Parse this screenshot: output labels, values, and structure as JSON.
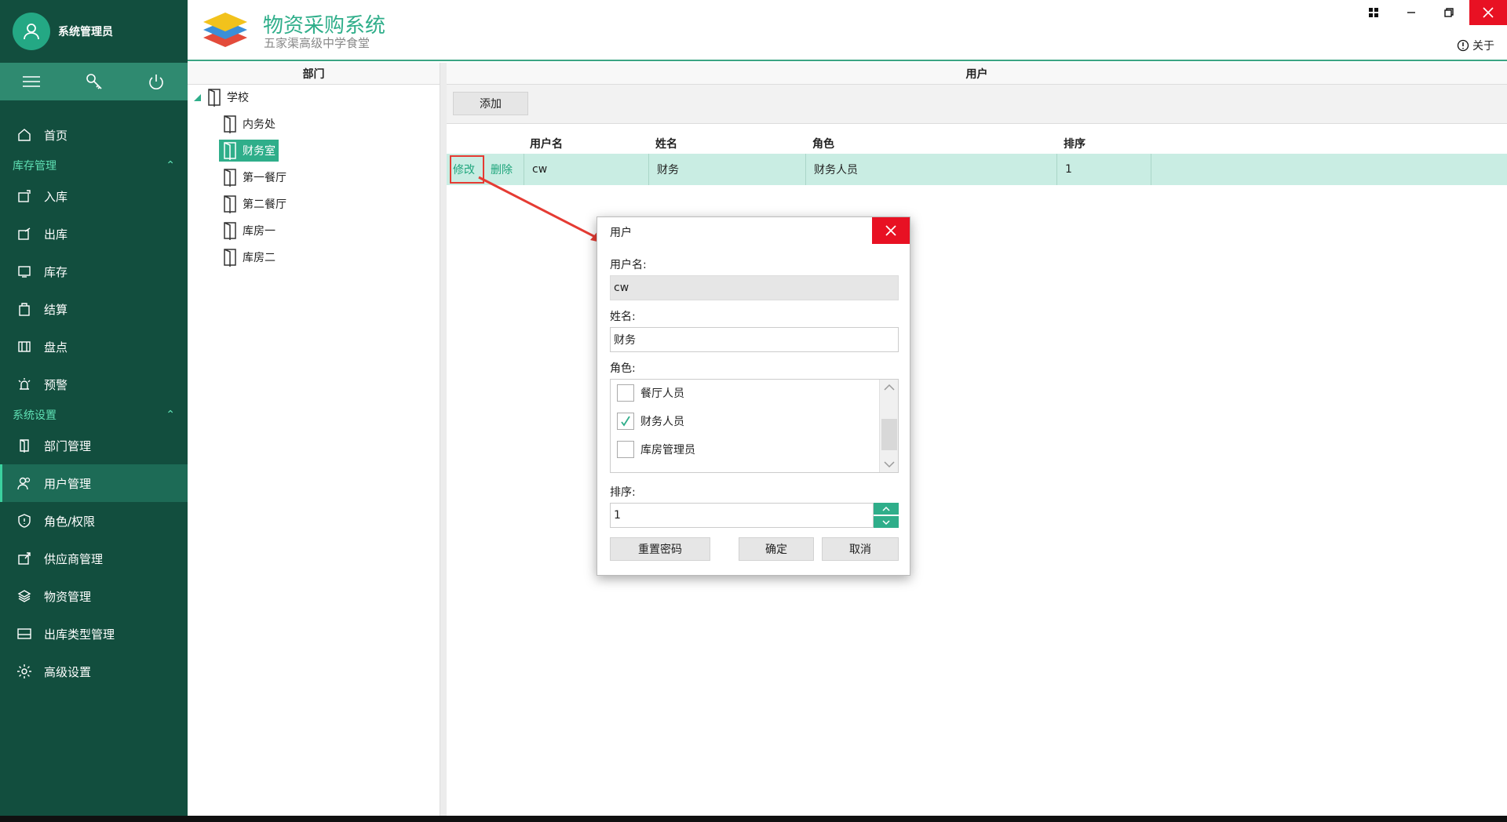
{
  "user": {
    "name": "系统管理员"
  },
  "app": {
    "title": "物资采购系统",
    "subtitle": "五家渠高级中学食堂",
    "about": "关于"
  },
  "sidebar": {
    "items_top": [
      {
        "label": "首页",
        "icon": "home-icon"
      }
    ],
    "group1": "库存管理",
    "group1_items": [
      {
        "label": "入库",
        "icon": "stock-in-icon"
      },
      {
        "label": "出库",
        "icon": "stock-out-icon"
      },
      {
        "label": "库存",
        "icon": "inventory-icon"
      },
      {
        "label": "结算",
        "icon": "settlement-icon"
      },
      {
        "label": "盘点",
        "icon": "stocktake-icon"
      },
      {
        "label": "预警",
        "icon": "alarm-icon"
      }
    ],
    "group2": "系统设置",
    "group2_items": [
      {
        "label": "部门管理",
        "icon": "door-icon"
      },
      {
        "label": "用户管理",
        "icon": "users-icon"
      },
      {
        "label": "角色/权限",
        "icon": "shield-icon"
      },
      {
        "label": "供应商管理",
        "icon": "supplier-icon"
      },
      {
        "label": "物资管理",
        "icon": "layers-icon"
      },
      {
        "label": "出库类型管理",
        "icon": "type-icon"
      },
      {
        "label": "高级设置",
        "icon": "gear-icon"
      }
    ]
  },
  "dept": {
    "header": "部门",
    "root": "学校",
    "children": [
      "内务处",
      "财务室",
      "第一餐厅",
      "第二餐厅",
      "库房一",
      "库房二"
    ],
    "selected": "财务室"
  },
  "users": {
    "header": "用户",
    "add_label": "添加",
    "columns": [
      "用户名",
      "姓名",
      "角色",
      "排序"
    ],
    "row": {
      "edit": "修改",
      "delete": "删除",
      "username": "cw",
      "name": "财务",
      "role": "财务人员",
      "order": "1"
    }
  },
  "dialog": {
    "title": "用户",
    "username_label": "用户名:",
    "username_value": "cw",
    "name_label": "姓名:",
    "name_value": "财务",
    "role_label": "角色:",
    "roles": [
      {
        "label": "餐厅人员",
        "checked": false
      },
      {
        "label": "财务人员",
        "checked": true
      },
      {
        "label": "库房管理员",
        "checked": false
      }
    ],
    "order_label": "排序:",
    "order_value": "1",
    "reset_label": "重置密码",
    "ok_label": "确定",
    "cancel_label": "取消"
  },
  "colors": {
    "sidebar": "#124e3e",
    "accent": "#2fae8a",
    "row_highlight": "#c9ede3",
    "close": "#e81123",
    "annotation": "#e53b33"
  }
}
